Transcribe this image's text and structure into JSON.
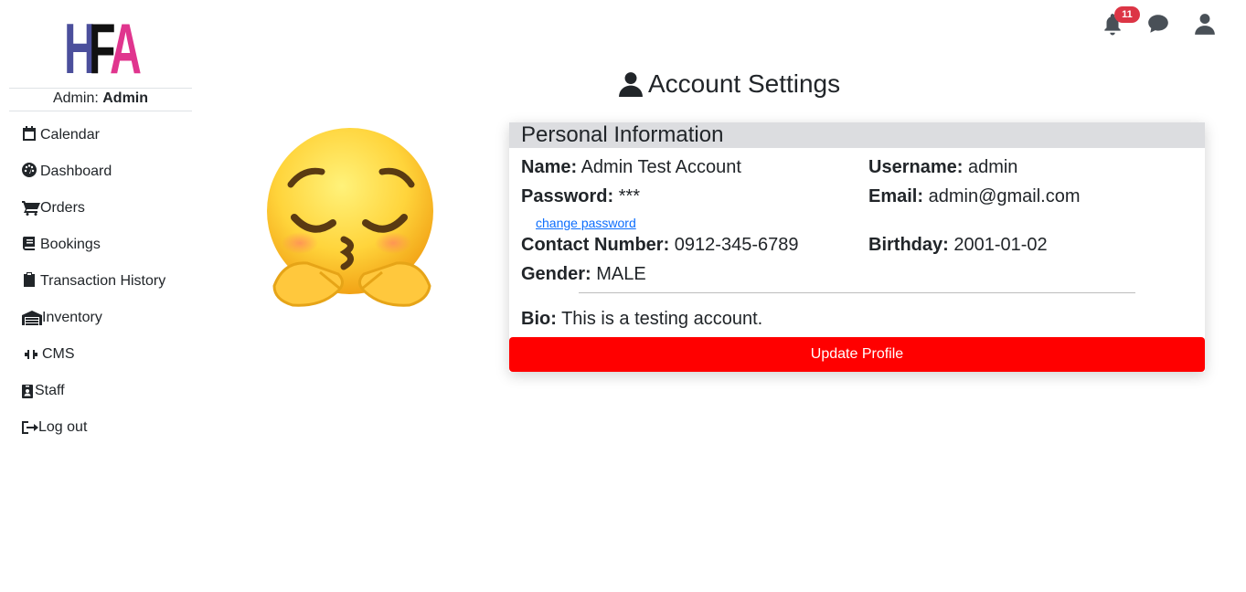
{
  "logo": {
    "letters": [
      "H",
      "F",
      "A"
    ],
    "colors": [
      "#4b4f9c",
      "#111111",
      "#e0358e"
    ]
  },
  "sidebar": {
    "admin_prefix": "Admin: ",
    "admin_name": "Admin",
    "items": [
      {
        "label": "Calendar",
        "icon": "calendar-icon"
      },
      {
        "label": "Dashboard",
        "icon": "gauge-icon"
      },
      {
        "label": "Orders",
        "icon": "cart-icon"
      },
      {
        "label": "Bookings",
        "icon": "book-icon"
      },
      {
        "label": "Transaction History",
        "icon": "clipboard-icon"
      },
      {
        "label": "Inventory",
        "icon": "warehouse-icon"
      },
      {
        "label": "CMS",
        "icon": "compress-icon"
      },
      {
        "label": "Staff",
        "icon": "id-badge-icon"
      },
      {
        "label": "Log out",
        "icon": "sign-out-icon"
      }
    ]
  },
  "topbar": {
    "notification_count": "11",
    "icons": [
      "bell-icon",
      "chat-icon",
      "user-icon"
    ]
  },
  "page_title": "Account Settings",
  "avatar": {
    "icon": "pleading-face-emoji"
  },
  "card": {
    "header": "Personal Information",
    "name_label": "Name:",
    "name_value": "Admin Test Account",
    "username_label": "Username:",
    "username_value": "admin",
    "password_label": "Password:",
    "password_value": "***",
    "change_password": "change password",
    "email_label": "Email:",
    "email_value": "admin@gmail.com",
    "contact_label": "Contact Number:",
    "contact_value": "0912-345-6789",
    "birthday_label": "Birthday:",
    "birthday_value": "2001-01-02",
    "gender_label": "Gender:",
    "gender_value": "MALE",
    "bio_label": "Bio:",
    "bio_value": "This is a testing account.",
    "update_button": "Update Profile"
  },
  "colors": {
    "accent": "#ff0000",
    "badge": "#dc3545",
    "header_bg": "#dcdde0",
    "link": "#0d6efd"
  }
}
